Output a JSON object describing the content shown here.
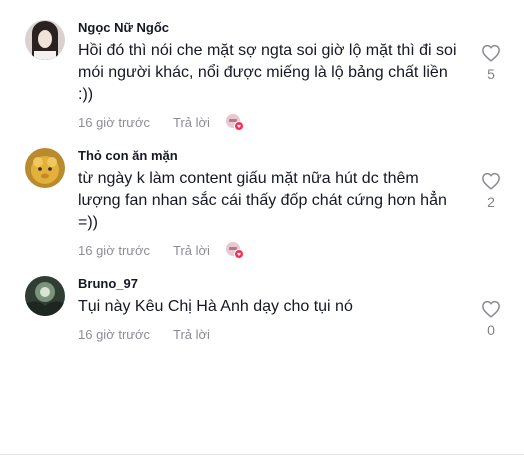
{
  "comments": [
    {
      "username": "Ngọc Nữ Ngốc",
      "text": "Hồi đó thì nói che mặt sợ ngta soi giờ lộ mặt thì đi soi mói người khác, nổi được miếng là lộ bảng chất liền :))",
      "time": "16 giờ trước",
      "reply_label": "Trả lời",
      "likes": "5"
    },
    {
      "username": "Thỏ con ăn mặn",
      "text": "từ ngày k làm content giấu mặt nữa hút dc thêm lượng fan nhan sắc cái thấy đốp chát cứng hơn hẳn =))",
      "time": "16 giờ trước",
      "reply_label": "Trả lời",
      "likes": "2"
    },
    {
      "username": "Bruno_97",
      "text": "Tụi này Kêu Chị Hà Anh dạy cho tụi nó",
      "time": "16 giờ trước",
      "reply_label": "Trả lời",
      "likes": "0"
    }
  ],
  "colors": {
    "text_primary": "#161823",
    "reaction_badge": "#fe2c55"
  }
}
